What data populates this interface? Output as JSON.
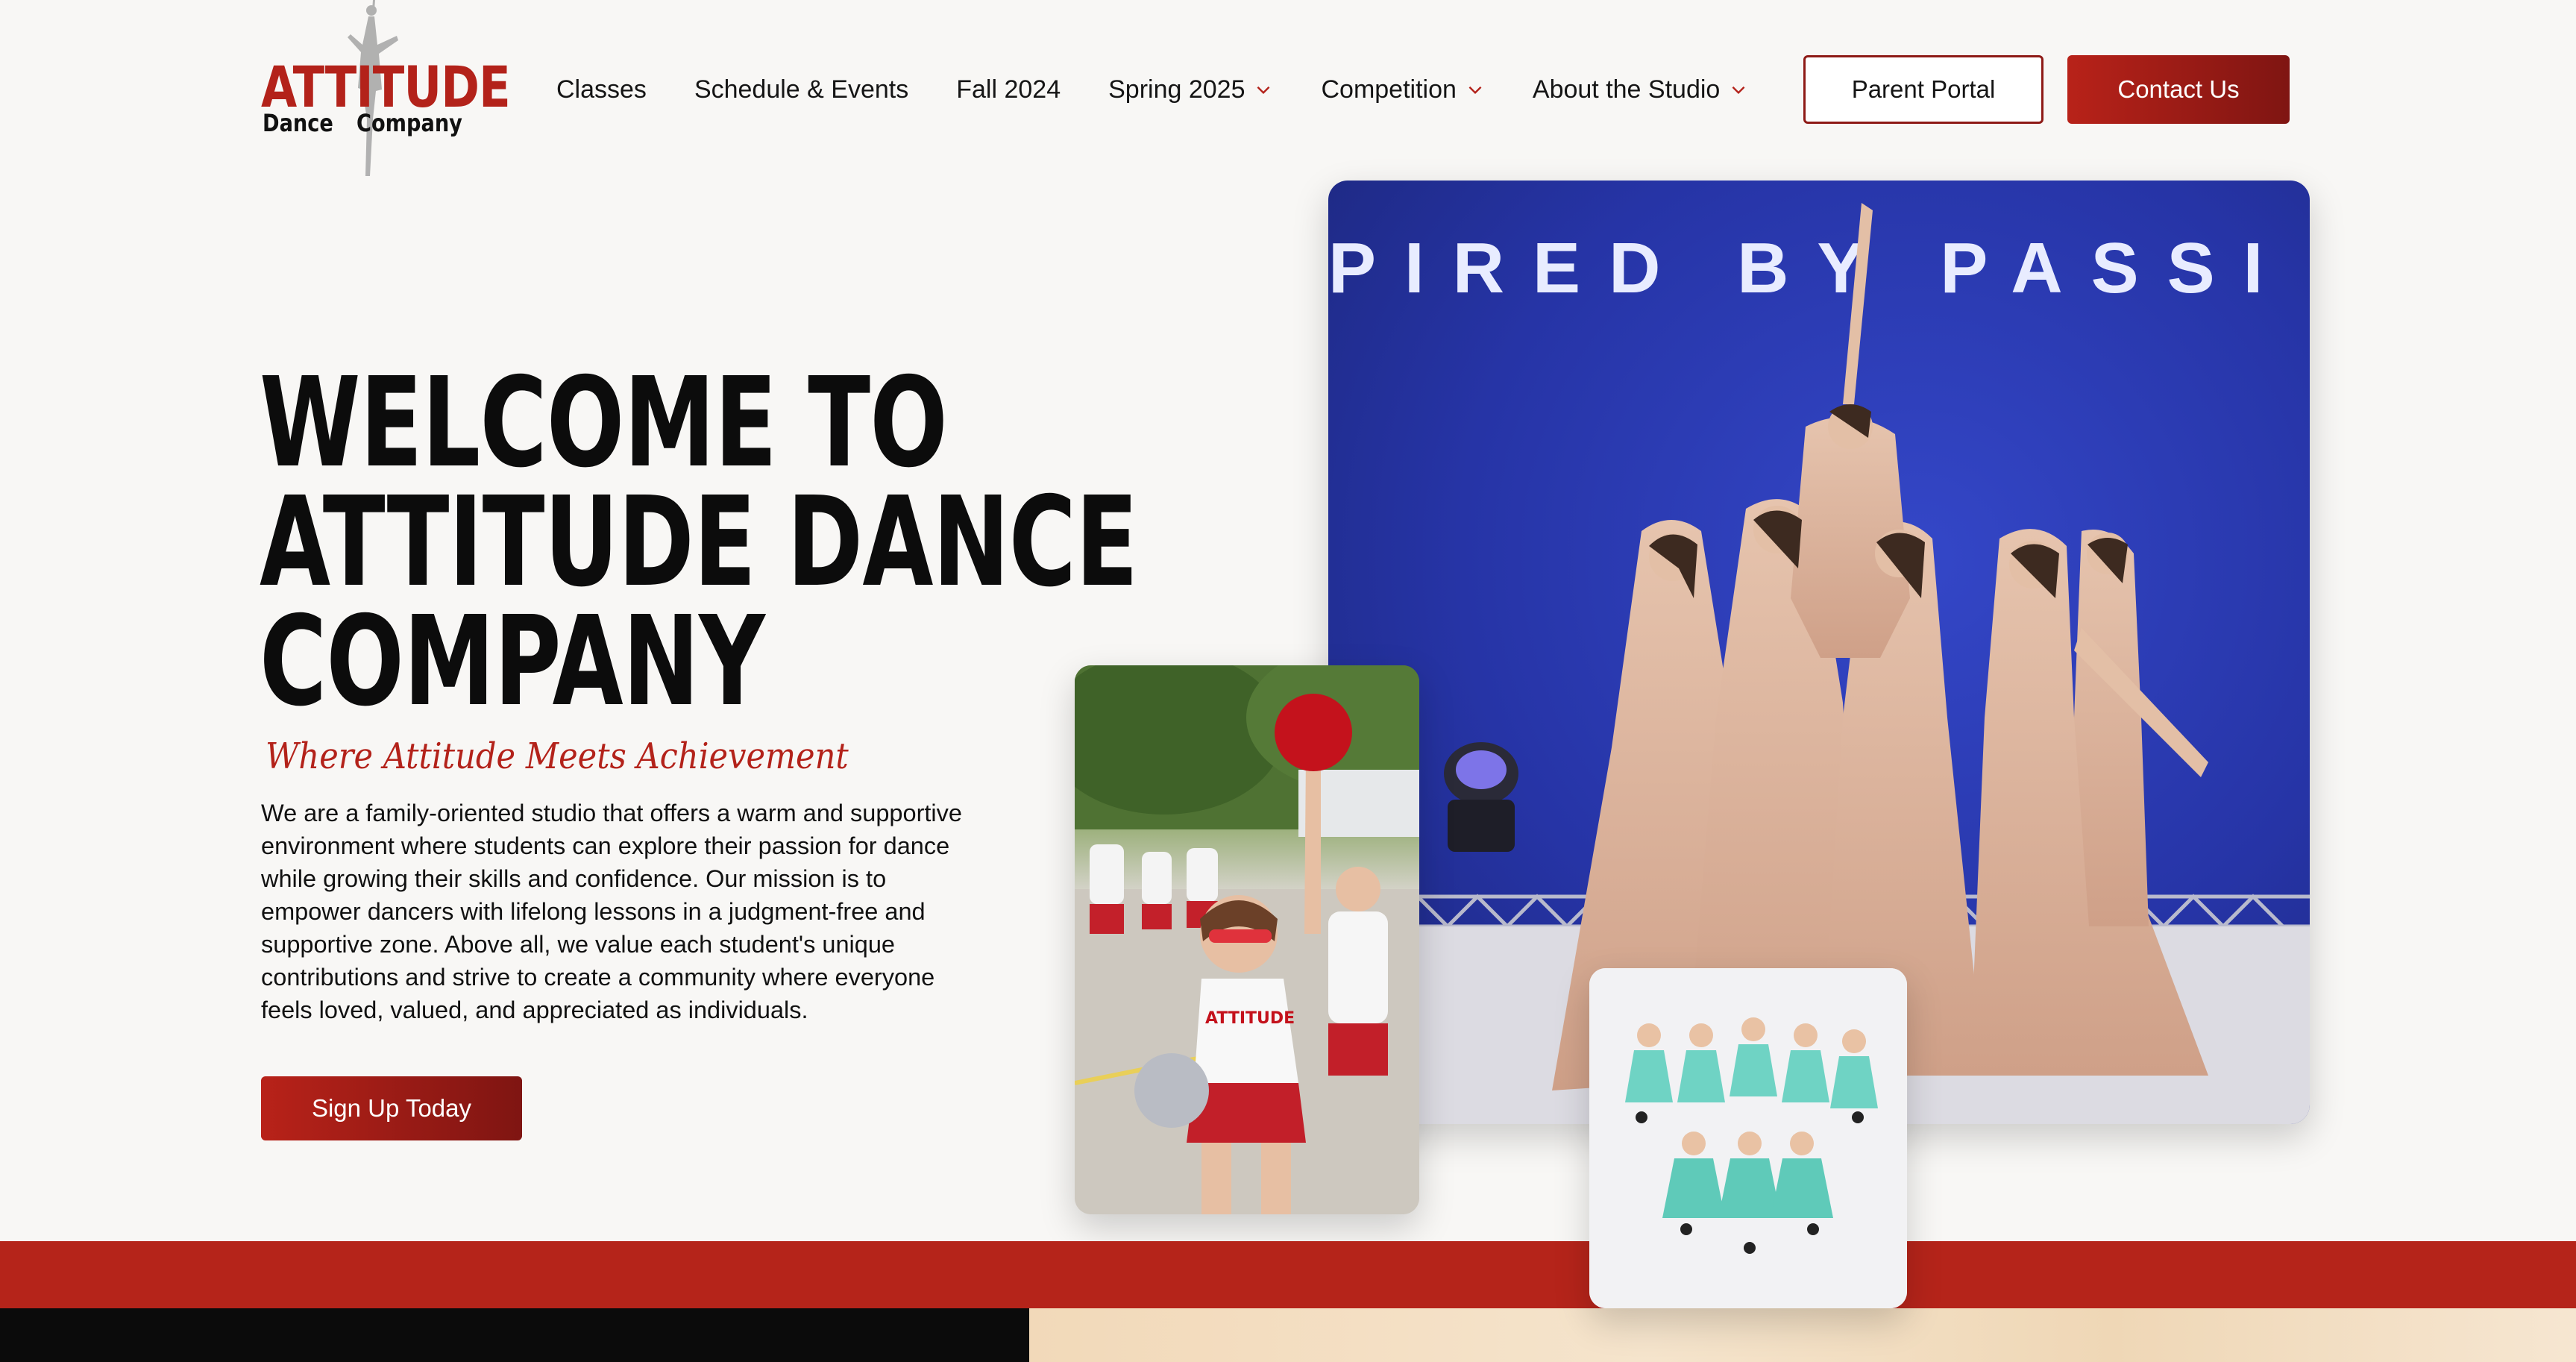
{
  "logo": {
    "brand": "ATTITUDE",
    "sub_left": "Dance",
    "sub_right": "Company"
  },
  "nav": {
    "items": [
      {
        "label": "Classes",
        "has_dropdown": false
      },
      {
        "label": "Schedule & Events",
        "has_dropdown": false
      },
      {
        "label": "Fall 2024",
        "has_dropdown": false
      },
      {
        "label": "Spring 2025",
        "has_dropdown": true
      },
      {
        "label": "Competition",
        "has_dropdown": true
      },
      {
        "label": "About the Studio",
        "has_dropdown": true
      }
    ],
    "parent_portal": "Parent Portal",
    "contact": "Contact Us"
  },
  "hero": {
    "title_lines": [
      "WELCOME TO",
      "ATTITUDE DANCE",
      "COMPANY"
    ],
    "tagline": "Where Attitude Meets Achievement",
    "intro": "We are a family-oriented studio that offers a warm and supportive environment where students can explore their passion for dance while growing their skills and confidence. Our mission is to empower dancers with lifelong lessons in a judgment-free and supportive zone. Above all, we value each student's unique contributions and strive to create a community where everyone feels loved, valued, and appreciated as individuals.",
    "cta": "Sign Up Today"
  },
  "photos": {
    "main_banner_text": "PIRED BY PASSI",
    "parade_shirt_text": "ATTITUDE"
  },
  "colors": {
    "accent": "#b3221a",
    "accent_dark": "#7f1512",
    "band": "#b5241a",
    "stage_blue": "#2a38b0"
  }
}
